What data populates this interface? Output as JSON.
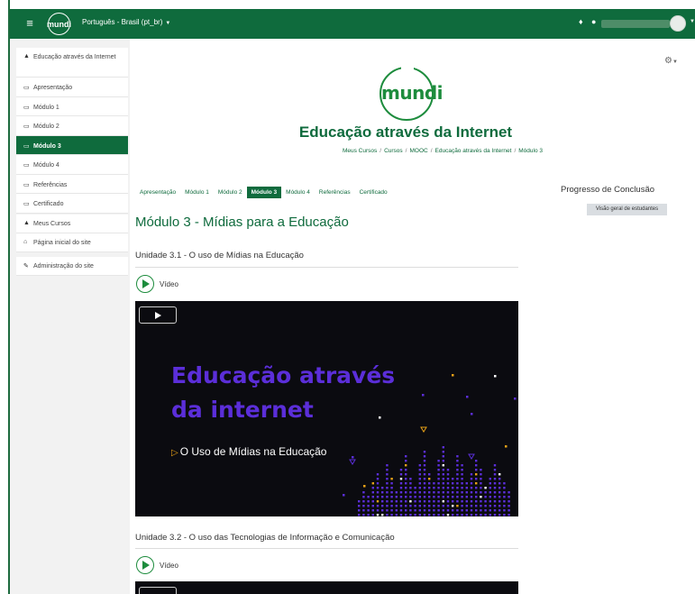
{
  "navbar": {
    "logo_text": "mundi",
    "language": "Português - Brasil (pt_br)",
    "hamburger_glyph": "≡",
    "bell_glyph": "🔔",
    "chat_glyph": "💬",
    "caret": "▼"
  },
  "drawer": {
    "course_items": [
      {
        "label": "Educação através da Internet",
        "icon": "graduation-cap-icon",
        "glyph": "🎓",
        "active": false
      },
      {
        "label": "Apresentação",
        "icon": "folder-icon",
        "glyph": "🗀",
        "active": false
      },
      {
        "label": "Módulo 1",
        "icon": "folder-icon",
        "glyph": "🗀",
        "active": false
      },
      {
        "label": "Módulo 2",
        "icon": "folder-icon",
        "glyph": "🗀",
        "active": false
      },
      {
        "label": "Módulo 3",
        "icon": "folder-icon",
        "glyph": "🗀",
        "active": true
      },
      {
        "label": "Módulo 4",
        "icon": "folder-icon",
        "glyph": "🗀",
        "active": false
      },
      {
        "label": "Referências",
        "icon": "folder-icon",
        "glyph": "🗀",
        "active": false
      },
      {
        "label": "Certificado",
        "icon": "folder-icon",
        "glyph": "🗀",
        "active": false
      }
    ],
    "site_items": [
      {
        "label": "Meus Cursos",
        "icon": "courses-icon",
        "glyph": "🎓"
      },
      {
        "label": "Página inicial do site",
        "icon": "home-icon",
        "glyph": "🏠"
      }
    ],
    "admin_items": [
      {
        "label": "Administração do site",
        "icon": "wrench-icon",
        "glyph": "🔧"
      }
    ]
  },
  "header": {
    "logo_text": "mundi",
    "course_title": "Educação através da Internet",
    "breadcrumb": [
      "Meus Cursos",
      "Cursos",
      "MOOC",
      "Educação através da Internet",
      "Módulo 3"
    ],
    "gear_glyph": "⚙"
  },
  "tabs": [
    {
      "label": "Apresentação",
      "active": false
    },
    {
      "label": "Módulo 1",
      "active": false
    },
    {
      "label": "Módulo 2",
      "active": false
    },
    {
      "label": "Módulo 3",
      "active": true
    },
    {
      "label": "Módulo 4",
      "active": false
    },
    {
      "label": "Referências",
      "active": false
    },
    {
      "label": "Certificado",
      "active": false
    }
  ],
  "main": {
    "module_title": "Módulo 3 - Mídias para a Educação",
    "units": [
      {
        "title": "Unidade 3.1 - O uso de Mídias na Educação",
        "activity": "Vídeo"
      },
      {
        "title": "Unidade 3.2 - O uso das Tecnologias de Informação e Comunicação",
        "activity": "Vídeo"
      }
    ],
    "video": {
      "title_line1": "Educação através",
      "title_line2": "da internet",
      "subtitle": "O Uso de Mídias na Educação",
      "subtitle_marker": "▷"
    }
  },
  "progress": {
    "title": "Progresso de Conclusão",
    "overview_button": "Visão geral de estudantes"
  },
  "colors": {
    "brand_green": "#0f6b3d",
    "logo_green": "#1d8c3d",
    "video_purple": "#5b2ed9",
    "video_accent": "#e8a217"
  }
}
